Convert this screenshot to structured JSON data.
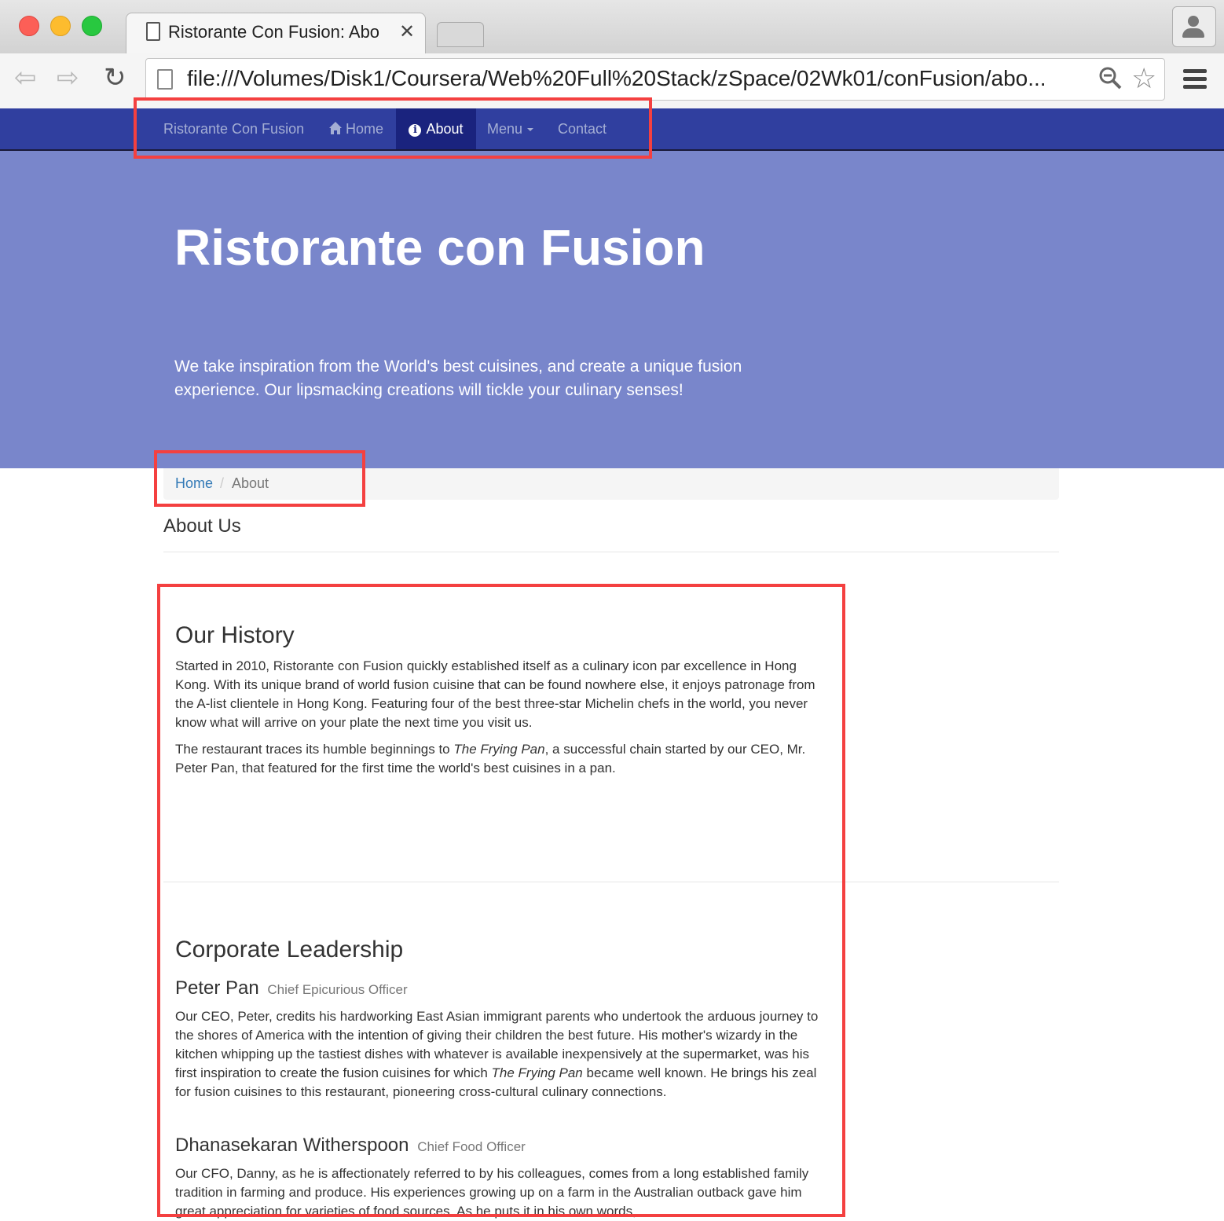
{
  "browser": {
    "tab_title": "Ristorante Con Fusion: Abo",
    "tab_close": "✕",
    "url": "file:///Volumes/Disk1/Coursera/Web%20Full%20Stack/zSpace/02Wk01/conFusion/abo...",
    "back": "⇦",
    "forward": "⇨",
    "reload": "↻",
    "star": "☆"
  },
  "navbar": {
    "brand": "Ristorante Con Fusion",
    "items": [
      {
        "label": "Home",
        "icon": "home-icon"
      },
      {
        "label": "About",
        "icon": "info-icon",
        "active": true
      },
      {
        "label": "Menu",
        "icon": "caret-down-icon"
      },
      {
        "label": "Contact"
      }
    ],
    "bg_color": "#303f9f",
    "active_color": "#1a237e"
  },
  "jumbotron": {
    "title": "Ristorante con Fusion",
    "text": "We take inspiration from the World's best cuisines, and create a unique fusion experience. Our lipsmacking creations will tickle your culinary senses!",
    "bg_color": "#7986cb"
  },
  "breadcrumb": {
    "home": "Home",
    "separator": "/",
    "current": "About"
  },
  "page": {
    "heading": "About Us",
    "history": {
      "title": "Our History",
      "p1": "Started in 2010, Ristorante con Fusion quickly established itself as a culinary icon par excellence in Hong Kong. With its unique brand of world fusion cuisine that can be found nowhere else, it enjoys patronage from the A-list clientele in Hong Kong. Featuring four of the best three-star Michelin chefs in the world, you never know what will arrive on your plate the next time you visit us.",
      "p2_before": "The restaurant traces its humble beginnings to ",
      "p2_em": "The Frying Pan",
      "p2_after": ", a successful chain started by our CEO, Mr. Peter Pan, that featured for the first time the world's best cuisines in a pan."
    },
    "leadership": {
      "title": "Corporate Leadership",
      "people": [
        {
          "name": "Peter Pan",
          "role": "Chief Epicurious Officer",
          "bio_before": "Our CEO, Peter, credits his hardworking East Asian immigrant parents who undertook the arduous journey to the shores of America with the intention of giving their children the best future. His mother's wizardy in the kitchen whipping up the tastiest dishes with whatever is available inexpensively at the supermarket, was his first inspiration to create the fusion cuisines for which ",
          "bio_em": "The Frying Pan",
          "bio_after": " became well known. He brings his zeal for fusion cuisines to this restaurant, pioneering cross-cultural culinary connections."
        },
        {
          "name": "Dhanasekaran Witherspoon",
          "role": "Chief Food Officer",
          "bio": "Our CFO, Danny, as he is affectionately referred to by his colleagues, comes from a long established family tradition in farming and produce. His experiences growing up on a farm in the Australian outback gave him great appreciation for varieties of food sources. As he puts it in his own words,"
        }
      ]
    }
  },
  "annotation_color": "#f44040"
}
